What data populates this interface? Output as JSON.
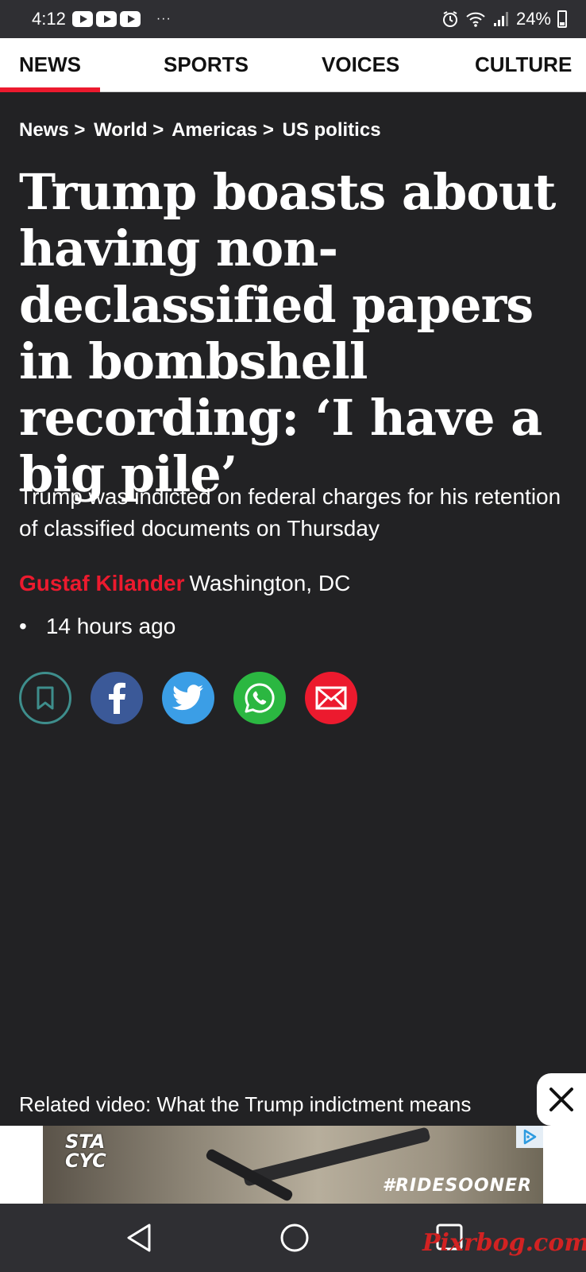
{
  "status_bar": {
    "time": "4:12",
    "more": "···",
    "battery": "24%"
  },
  "nav_tabs": [
    {
      "label": "NEWS",
      "active": true
    },
    {
      "label": "SPORTS",
      "active": false
    },
    {
      "label": "VOICES",
      "active": false
    },
    {
      "label": "CULTURE",
      "active": false
    }
  ],
  "breadcrumb": [
    "News",
    "World",
    "Americas",
    "US politics"
  ],
  "breadcrumb_separator": ">",
  "article": {
    "headline": "Trump boasts about having non-declassified papers in bombshell recording: ‘I have a big pile’",
    "standfirst": "Trump was indicted on federal charges for his retention of classified documents on Thursday",
    "author": "Gustaf Kilander",
    "location": "Washington, DC",
    "bullet": "•",
    "published": "14 hours ago"
  },
  "share_buttons": [
    {
      "icon": "bookmark-icon",
      "color": "#3e8e8c"
    },
    {
      "icon": "facebook-icon",
      "color": "#3b5998"
    },
    {
      "icon": "twitter-icon",
      "color": "#3b9ee6"
    },
    {
      "icon": "whatsapp-icon",
      "color": "#2bb741"
    },
    {
      "icon": "email-icon",
      "color": "#ec1a2e"
    }
  ],
  "related_video": {
    "label": "Related video: What the Trump indictment means"
  },
  "ad": {
    "brand_line1": "STA",
    "brand_line2": "CYC",
    "slogan": "#RIDESOONER"
  },
  "watermark": "Pixrbog.com",
  "colors": {
    "accent": "#ec1a2e",
    "background": "#222224",
    "status_bar": "#2f2f33"
  }
}
